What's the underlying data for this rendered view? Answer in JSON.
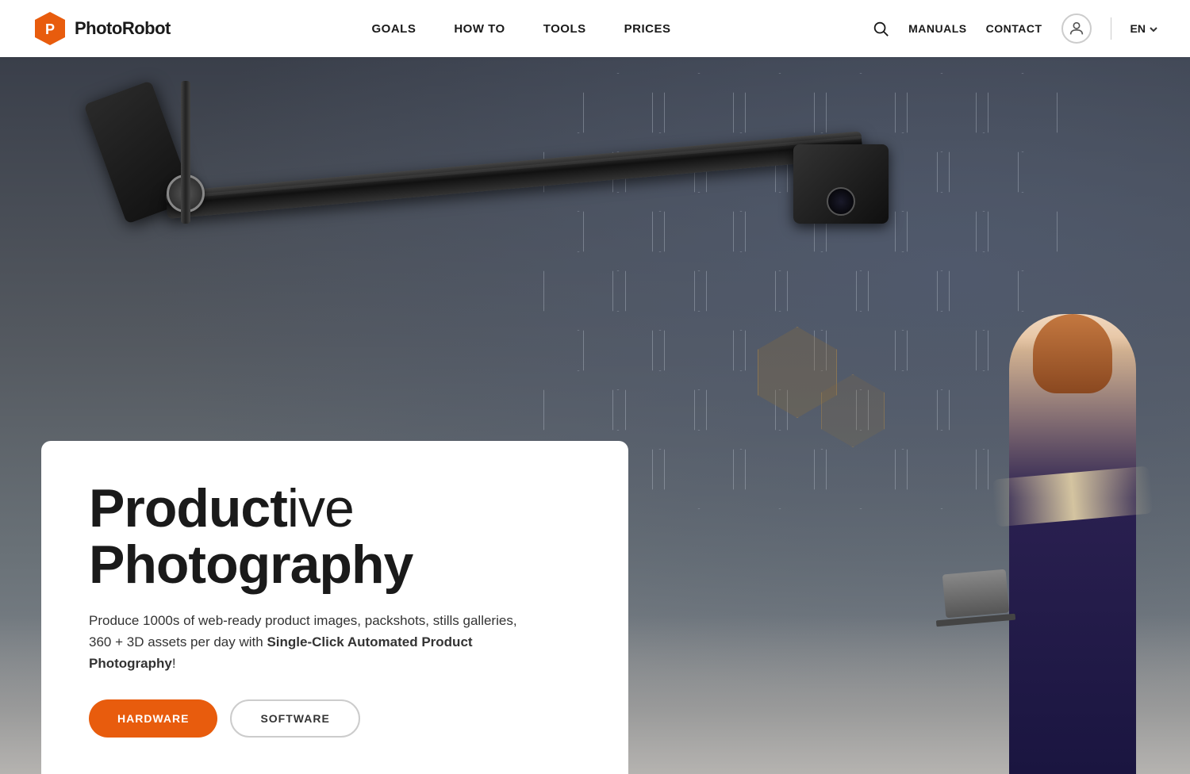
{
  "navbar": {
    "logo_text": "PhotoRobot",
    "nav_links": [
      {
        "label": "GOALS",
        "id": "goals"
      },
      {
        "label": "HOW TO",
        "id": "howto"
      },
      {
        "label": "TOOLS",
        "id": "tools"
      },
      {
        "label": "PRICES",
        "id": "prices"
      }
    ],
    "right_links": [
      {
        "label": "MANUALS",
        "id": "manuals"
      },
      {
        "label": "CONTACT",
        "id": "contact"
      }
    ],
    "lang": "EN"
  },
  "hero": {
    "title_bold": "Product",
    "title_light": "ive",
    "title_line2": "Photography",
    "subtitle": "Produce 1000s of web-ready product images, packshots, stills galleries, 360 + 3D assets per day with ",
    "subtitle_bold": "Single-Click Automated Product Photography",
    "subtitle_end": "!",
    "btn_hardware": "HARDWARE",
    "btn_software": "SOFTWARE"
  },
  "colors": {
    "brand_orange": "#e85c0d",
    "nav_bg": "#ffffff",
    "hero_dark": "#3a3f4a",
    "card_bg": "#ffffff",
    "text_dark": "#1a1a1a",
    "text_mid": "#333333"
  }
}
